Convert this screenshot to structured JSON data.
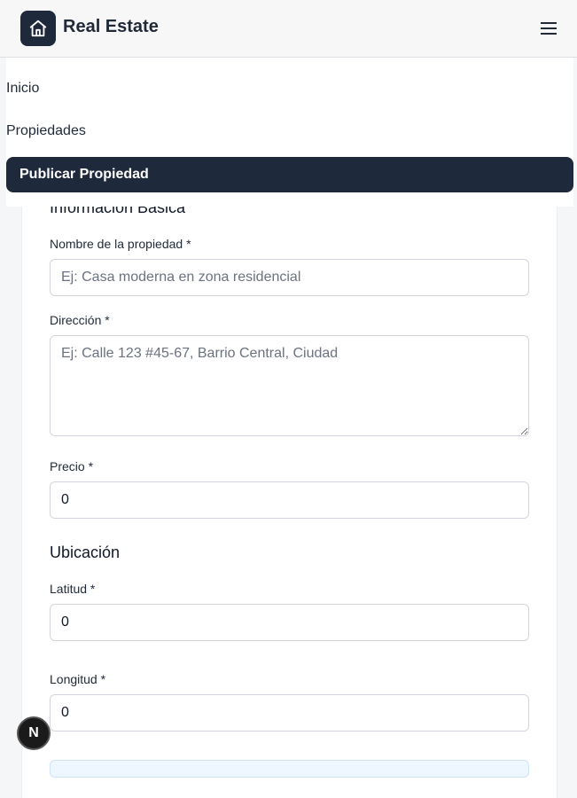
{
  "header": {
    "brand": "Real Estate",
    "logo_icon": "house-icon",
    "menu_icon": "hamburger-menu-icon"
  },
  "nav": {
    "items": [
      {
        "label": "Inicio",
        "active": false
      },
      {
        "label": "Propiedades",
        "active": false
      },
      {
        "label": "Publicar Propiedad",
        "active": true
      }
    ]
  },
  "form": {
    "section_basic": "Información Básica",
    "name_label": "Nombre de la propiedad *",
    "name_placeholder": "Ej: Casa moderna en zona residencial",
    "address_label": "Dirección *",
    "address_placeholder": "Ej: Calle 123 #45-67, Barrio Central, Ciudad",
    "price_label": "Precio *",
    "price_value": "0",
    "section_location": "Ubicación",
    "lat_label": "Latitud *",
    "lat_value": "0",
    "lng_label": "Longitud *",
    "lng_value": "0"
  },
  "badge": {
    "letter": "N"
  }
}
